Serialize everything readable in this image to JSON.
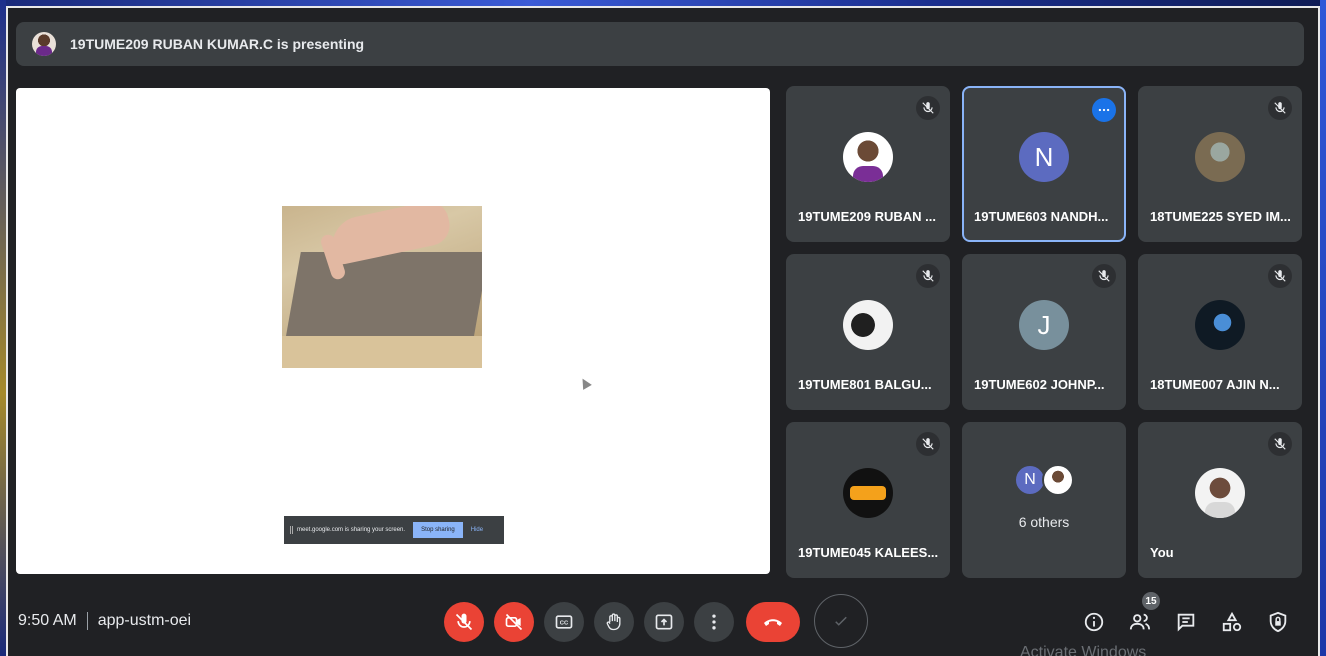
{
  "presenting_banner": {
    "text": "19TUME209 RUBAN KUMAR.C is presenting"
  },
  "share_notice": {
    "message": "meet.google.com is sharing your screen.",
    "stop_label": "Stop sharing",
    "hide_label": "Hide"
  },
  "participants": [
    {
      "name": "19TUME209 RUBAN ...",
      "muted": true
    },
    {
      "name": "19TUME603 NANDH...",
      "initial": "N",
      "active": true
    },
    {
      "name": "18TUME225 SYED IM...",
      "muted": true
    },
    {
      "name": "19TUME801 BALGU...",
      "muted": true
    },
    {
      "name": "19TUME602 JOHNP...",
      "initial": "J",
      "muted": true
    },
    {
      "name": "18TUME007 AJIN N...",
      "muted": true
    },
    {
      "name": "19TUME045 KALEES...",
      "muted": true
    },
    {
      "others_label": "6 others",
      "initial": "N"
    },
    {
      "name": "You",
      "muted": true
    }
  ],
  "footer": {
    "time": "9:50 AM",
    "meeting_code": "app-ustm-oei",
    "people_count": "15",
    "watermark": "Activate Windows"
  },
  "icons": {
    "mic_off": "mic-off-icon",
    "cam_off": "camera-off-icon",
    "captions": "captions-icon",
    "raise_hand": "raise-hand-icon",
    "present": "present-icon",
    "more": "more-vert-icon",
    "end_call": "end-call-icon",
    "info": "info-icon",
    "people": "people-icon",
    "chat": "chat-icon",
    "activities": "activities-icon",
    "host_controls": "shield-lock-icon"
  },
  "colors": {
    "accent": "#8ab4f8",
    "danger": "#ea4335",
    "tile": "#3c4043",
    "background": "#202124"
  }
}
